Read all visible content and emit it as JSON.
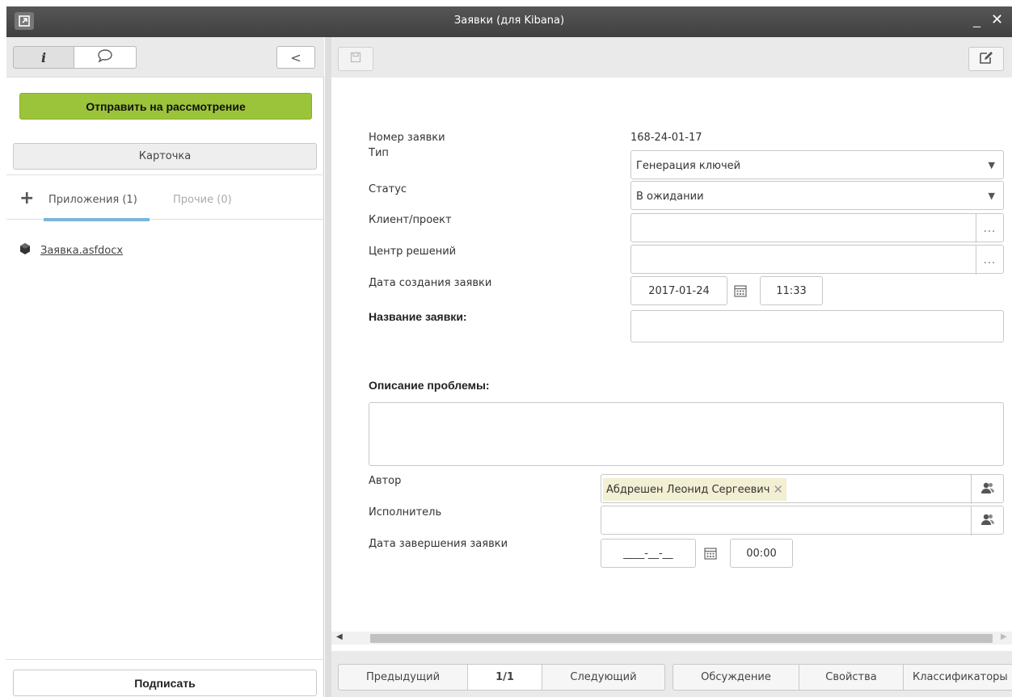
{
  "window": {
    "title": "Заявки (для Kibana)",
    "minimize": "_",
    "close": "✕"
  },
  "left_panel": {
    "tabs": [
      {
        "icon": "info-icon",
        "glyph": "i"
      },
      {
        "icon": "comment-icon",
        "glyph": "💬"
      }
    ],
    "collapse_glyph": "<",
    "send_button": "Отправить на рассмотрение",
    "card_button": "Карточка",
    "add_glyph": "+",
    "attachments_tab": "Приложения (1)",
    "other_tab": "Прочие (0)",
    "file_name": "Заявка.asfdocx",
    "sign_button": "Подписать"
  },
  "form": {
    "number_label": "Номер заявки",
    "number_value": "168-24-01-17",
    "type_label": "Тип",
    "type_value": "Генерация ключей",
    "status_label": "Статус",
    "status_value": "В ожидании",
    "client_label": "Клиент/проект",
    "client_value": "",
    "center_label": "Центр решений",
    "center_value": "",
    "created_label": "Дата создания заявки",
    "created_date": "2017-01-24",
    "created_time": "11:33",
    "name_label": "Название заявки:",
    "name_value": "",
    "description_label": "Описание проблемы:",
    "description_value": "",
    "author_label": "Автор",
    "author_value": "Абдрешен Леонид Сергеевич",
    "executor_label": "Исполнитель",
    "executor_value": "",
    "finish_label": "Дата завершения заявки",
    "finish_date": "____-__-__",
    "finish_time": "00:00",
    "dots": "...",
    "dropdown_arrow": "▼"
  },
  "bottom_nav": {
    "prev": "Предыдущий",
    "page": "1/1",
    "next": "Следующий",
    "discussion": "Обсуждение",
    "properties": "Свойства",
    "classifiers": "Классификаторы"
  },
  "colors": {
    "send_button": "#9cc43a",
    "active_tab_underline": "#7ab6db",
    "author_chip": "#f3efd3",
    "titlebar": "#4a4a4a"
  }
}
